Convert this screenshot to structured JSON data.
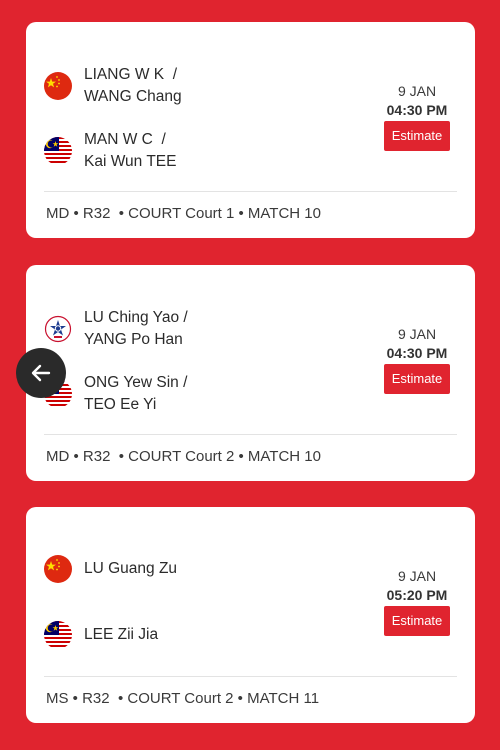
{
  "colors": {
    "background": "#e0242f",
    "accent": "#e0242f",
    "card": "#ffffff"
  },
  "matches": [
    {
      "team1": {
        "flag": "china-flag-icon",
        "players": [
          "LIANG W K  /",
          "WANG Chang"
        ]
      },
      "team2": {
        "flag": "malaysia-flag-icon",
        "players": [
          "MAN W C  /",
          "Kai Wun TEE"
        ]
      },
      "date": "9 JAN",
      "time": "04:30 PM",
      "estimate_label": "Estimate",
      "meta": "MD • R32  • COURT Court 1 • MATCH 10"
    },
    {
      "team1": {
        "flag": "chinese-taipei-flag-icon",
        "players": [
          "LU Ching Yao /",
          "YANG Po Han"
        ]
      },
      "team2": {
        "flag": "malaysia-flag-icon",
        "players": [
          "ONG Yew Sin /",
          "TEO Ee Yi"
        ]
      },
      "date": "9 JAN",
      "time": "04:30 PM",
      "estimate_label": "Estimate",
      "meta": "MD • R32  • COURT Court 2 • MATCH 10"
    },
    {
      "team1": {
        "flag": "china-flag-icon",
        "players": [
          "LU Guang Zu"
        ]
      },
      "team2": {
        "flag": "malaysia-flag-icon",
        "players": [
          "LEE Zii Jia"
        ]
      },
      "date": "9 JAN",
      "time": "05:20 PM",
      "estimate_label": "Estimate",
      "meta": "MS • R32  • COURT Court 2 • MATCH 11"
    }
  ],
  "back_button": {
    "icon": "arrow-left-icon"
  }
}
